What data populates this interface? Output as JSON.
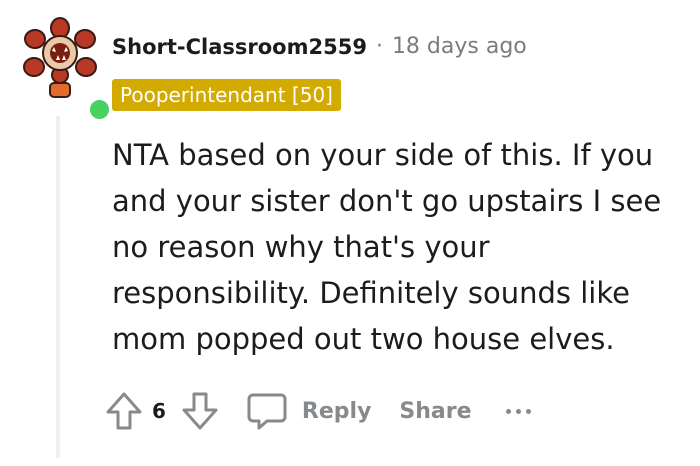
{
  "comment": {
    "username": "Short-Classroom2559",
    "separator": "·",
    "timestamp": "18 days ago",
    "flair": "Pooperintendant [50]",
    "body": "NTA based on your side of this. If you and your sister don't go upstairs I see no reason why that's your responsibility. Definitely sounds like mom popped out two house elves.",
    "vote_count": "6"
  },
  "actions": {
    "reply_label": "Reply",
    "share_label": "Share"
  },
  "icons": {
    "avatar": "demogorgon-avatar",
    "online": "online-status-dot",
    "upvote": "upvote-arrow-icon",
    "downvote": "downvote-arrow-icon",
    "reply": "speech-bubble-icon",
    "more": "more-dots-icon"
  },
  "colors": {
    "flair_bg": "#d3ab00",
    "online": "#46d160",
    "muted": "#878a8c",
    "text": "#1c1c1c"
  }
}
